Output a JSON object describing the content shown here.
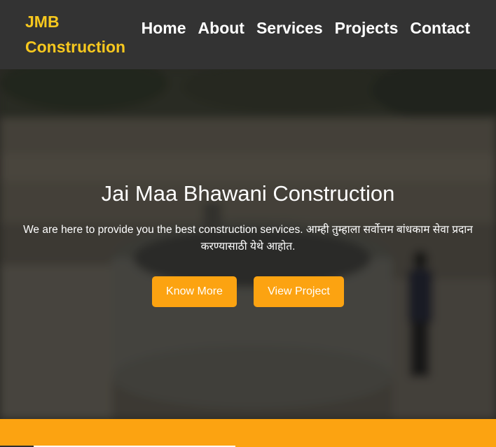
{
  "brand": {
    "line1": "JMB",
    "line2": "Construction",
    "color": "#f7c81e"
  },
  "nav": {
    "items": [
      "Home",
      "About",
      "Services",
      "Projects",
      "Contact"
    ]
  },
  "hero": {
    "title": "Jai Maa Bhawani Construction",
    "text": "We are here to provide you the best construction services. आम्ही तुम्हाला सर्वोत्तम बांधकाम सेवा प्रदान करण्यासाठी येथे आहोत.",
    "background": "blurred construction site photo with circular concrete well and worker",
    "buttons": {
      "know_more": "Know More",
      "view_project": "View Project"
    }
  },
  "colors": {
    "header_bg": "#333333",
    "accent": "#fca311",
    "text_light": "#ffffff"
  }
}
